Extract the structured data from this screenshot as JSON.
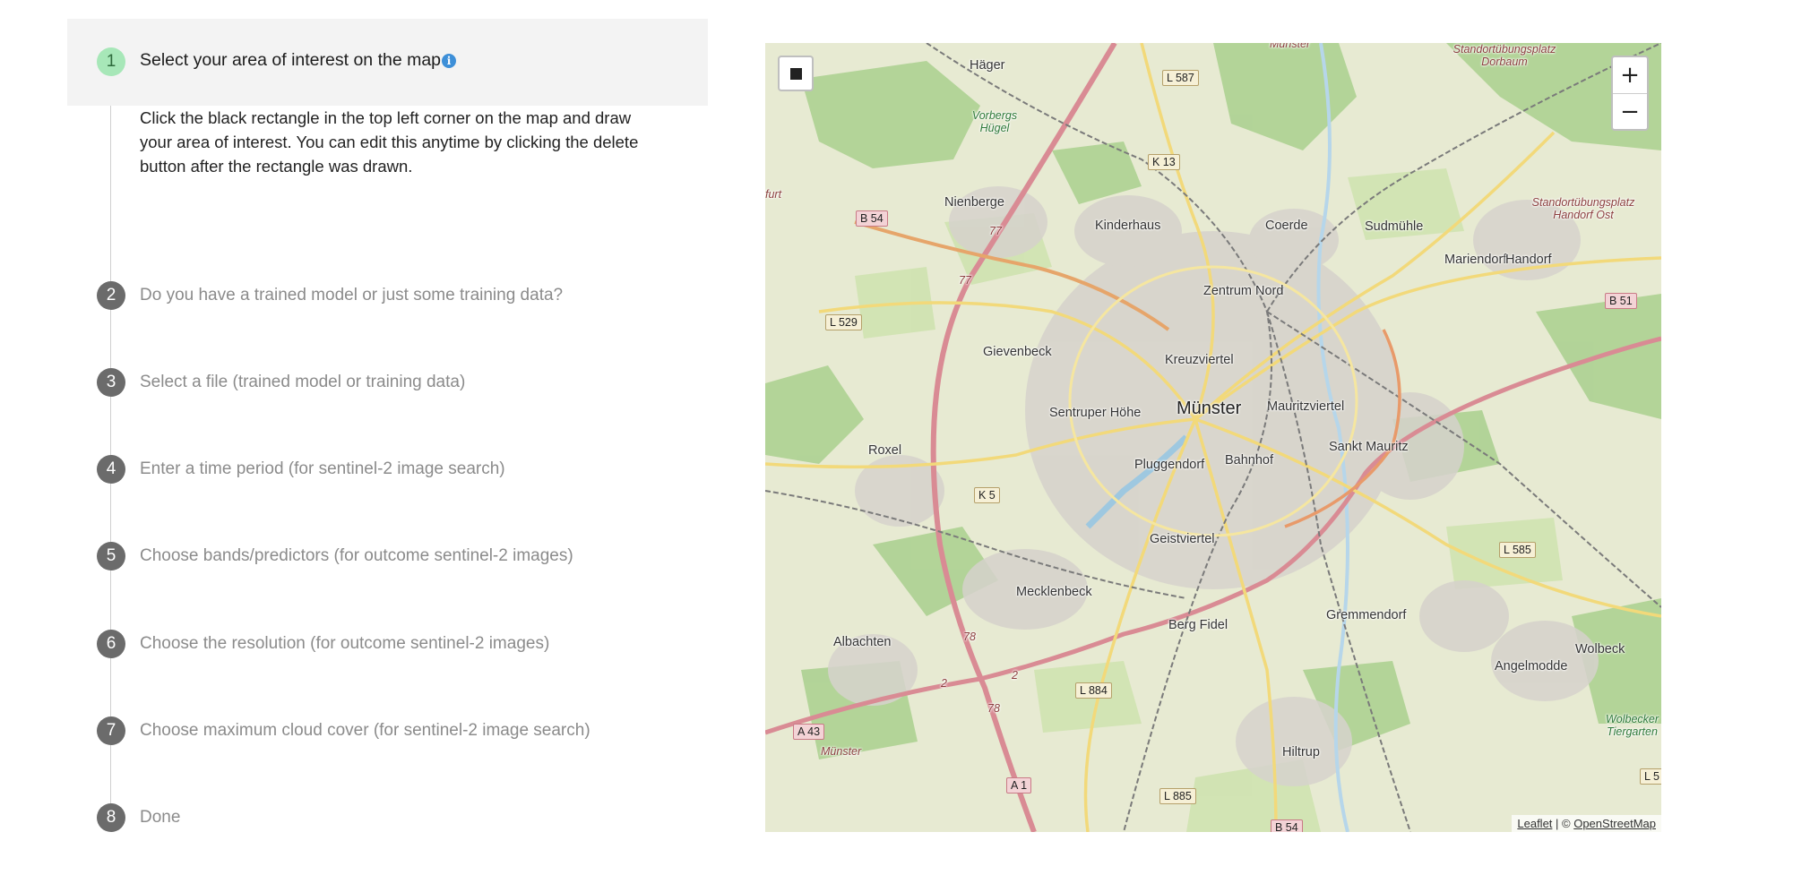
{
  "steps": [
    {
      "number": "1",
      "title": "Select your area of interest on the map",
      "active": true,
      "description": "Click the black rectangle in the top left corner on the map and draw your area of interest. You can edit this anytime by clicking the delete button after the rectangle was drawn."
    },
    {
      "number": "2",
      "title": "Do you have a trained model or just some training data?"
    },
    {
      "number": "3",
      "title": "Select a file (trained model or training data)"
    },
    {
      "number": "4",
      "title": "Enter a time period (for sentinel-2 image search)"
    },
    {
      "number": "5",
      "title": "Choose bands/predictors (for outcome sentinel-2 images)"
    },
    {
      "number": "6",
      "title": "Choose the resolution (for outcome sentinel-2 images)"
    },
    {
      "number": "7",
      "title": "Choose maximum cloud cover (for sentinel-2 image search)"
    },
    {
      "number": "8",
      "title": "Done"
    }
  ],
  "info_icon_glyph": "i",
  "map": {
    "zoom_in": "+",
    "zoom_out": "−",
    "attribution": {
      "leaflet": "Leaflet",
      "separator": " | © ",
      "osm": "OpenStreetMap"
    },
    "city": "Münster",
    "places": [
      "Häger",
      "Nienberge",
      "Kinderhaus",
      "Coerde",
      "Sudmühle",
      "Mariendorf",
      "Handorf",
      "Zentrum Nord",
      "Gievenbeck",
      "Kreuzviertel",
      "Sentruper Höhe",
      "Mauritzviertel",
      "Roxel",
      "Pluggendorf",
      "Bahnhof",
      "Sankt Mauritz",
      "Geistviertel",
      "Mecklenbeck",
      "Berg Fidel",
      "Gremmendorf",
      "Albachten",
      "Wolbeck",
      "Angelmodde",
      "Hiltrup"
    ],
    "small_labels": [
      "Münster",
      "Standortübungsplatz Dorbaum",
      "Standortübungsplatz Handorf Ost",
      "Vorbergs Hügel",
      "Wolbecker Tiergarten",
      "Münster",
      "furt"
    ],
    "roads": [
      "L 587",
      "K 13",
      "B 54",
      "L 529",
      "B 51",
      "K 5",
      "L 585",
      "L 884",
      "A 43",
      "A 1",
      "L 885",
      "B 54",
      "L 5"
    ],
    "motorway_numbers": [
      "77",
      "77",
      "78",
      "2",
      "2",
      "78"
    ]
  }
}
